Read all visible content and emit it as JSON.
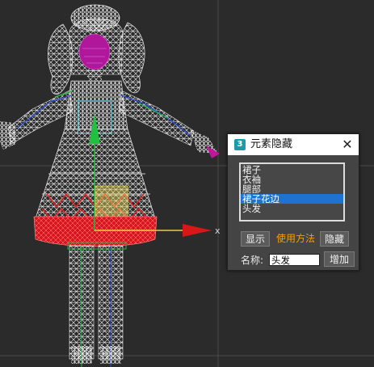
{
  "viewport": {
    "axis_x_label": "x",
    "colors": {
      "background": "#2b2b2b",
      "wireframe": "#f4f4f4",
      "skirt_red": "#e0202a",
      "gizmo_y": "#22c040",
      "gizmo_x": "#d81818",
      "gizmo_plane": "#f0e060"
    }
  },
  "dialog": {
    "app_icon": "3",
    "title": "元素隐藏",
    "close_icon": "✕",
    "list_items": [
      "裙子",
      "衣袖",
      "腿部",
      "裙子花边",
      "头发"
    ],
    "selected_index": 3,
    "show_button": "显示",
    "usage_link": "使用方法",
    "hide_button": "隐藏",
    "name_label": "名称:",
    "name_value": "头发",
    "add_button": "增加"
  }
}
